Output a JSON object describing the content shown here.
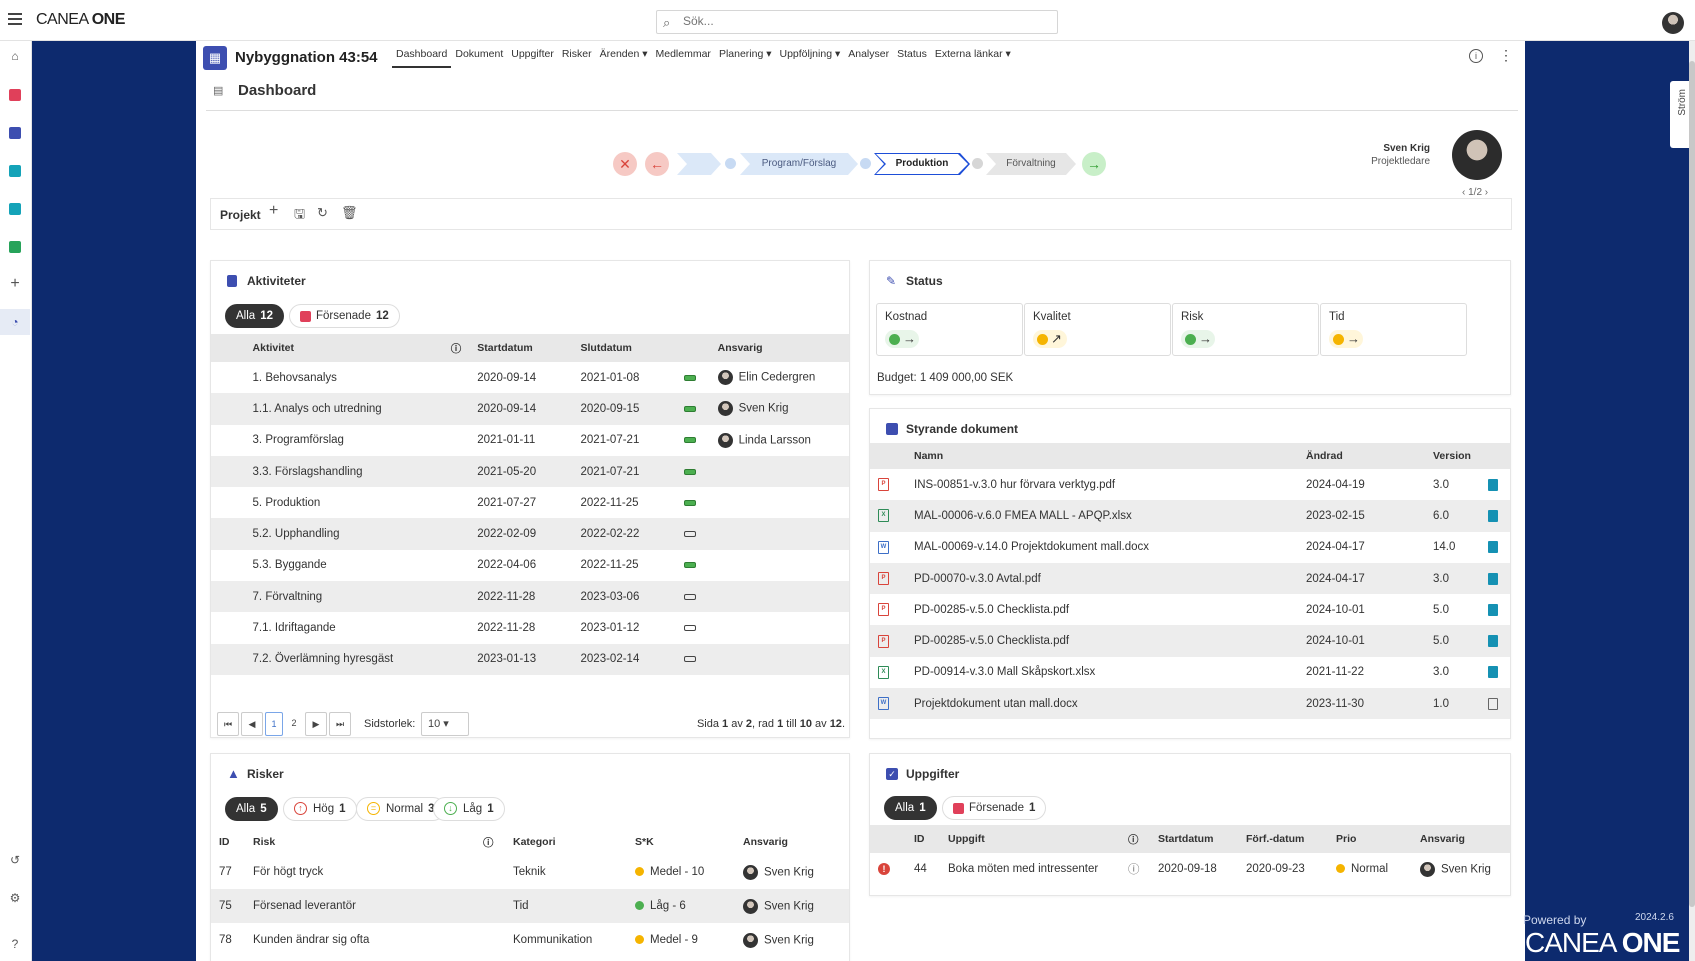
{
  "app": {
    "logo_light": "CANEA ",
    "logo_bold": "ONE"
  },
  "search": {
    "placeholder": "Sök..."
  },
  "project": {
    "title": "Nybyggnation 43:54",
    "tabs": [
      "Dashboard",
      "Dokument",
      "Uppgifter",
      "Risker",
      "Ärenden ▾",
      "Medlemmar",
      "Planering ▾",
      "Uppföljning ▾",
      "Analyser",
      "Status",
      "Externa länkar ▾"
    ],
    "active_tab": "Dashboard"
  },
  "page": {
    "title": "Dashboard"
  },
  "flow": {
    "steps": [
      "Program/Förslag",
      "Produktion",
      "Förvaltning"
    ],
    "active_step": "Produktion"
  },
  "manager": {
    "name": "Sven Krig",
    "role": "Projektledare",
    "pager": "1/2"
  },
  "toolbar": {
    "label": "Projekt"
  },
  "activities": {
    "title": "Aktiviteter",
    "filter_all_label": "Alla",
    "filter_all_count": "12",
    "filter_late_label": "Försenade",
    "filter_late_count": "12",
    "columns": [
      "Aktivitet",
      "Startdatum",
      "Slutdatum",
      "Ansvarig"
    ],
    "rows": [
      {
        "name": "1. Behovsanalys",
        "start": "2020-09-14",
        "end": "2021-01-08",
        "bar": "green",
        "owner": "Elin Cedergren"
      },
      {
        "name": "1.1. Analys och utredning",
        "start": "2020-09-14",
        "end": "2020-09-15",
        "bar": "green",
        "owner": "Sven Krig"
      },
      {
        "name": "3. Programförslag",
        "start": "2021-01-11",
        "end": "2021-07-21",
        "bar": "green",
        "owner": "Linda Larsson"
      },
      {
        "name": "3.3. Förslagshandling",
        "start": "2021-05-20",
        "end": "2021-07-21",
        "bar": "green",
        "owner": ""
      },
      {
        "name": "5. Produktion",
        "start": "2021-07-27",
        "end": "2022-11-25",
        "bar": "green",
        "owner": ""
      },
      {
        "name": "5.2. Upphandling",
        "start": "2022-02-09",
        "end": "2022-02-22",
        "bar": "empty",
        "owner": ""
      },
      {
        "name": "5.3. Byggande",
        "start": "2022-04-06",
        "end": "2022-11-25",
        "bar": "green",
        "owner": ""
      },
      {
        "name": "7. Förvaltning",
        "start": "2022-11-28",
        "end": "2023-03-06",
        "bar": "empty",
        "owner": ""
      },
      {
        "name": "7.1. Idriftagande",
        "start": "2022-11-28",
        "end": "2023-01-12",
        "bar": "empty",
        "owner": ""
      },
      {
        "name": "7.2. Överlämning hyresgäst",
        "start": "2023-01-13",
        "end": "2023-02-14",
        "bar": "empty",
        "owner": ""
      }
    ],
    "pager": {
      "pages": [
        "1",
        "2"
      ],
      "current": "1",
      "size_label": "Sidstorlek:",
      "size": "10",
      "summary_pre": "Sida ",
      "page": "1",
      "of": " av ",
      "total_pages": "2",
      "rad": ", rad ",
      "from": "1",
      "till": " till ",
      "to": "10",
      "av2": " av ",
      "total": "12",
      "dot": "."
    }
  },
  "status": {
    "title": "Status",
    "items": [
      {
        "label": "Kostnad",
        "color": "#4caf50",
        "trend": "→",
        "bg": "#e8f5e9"
      },
      {
        "label": "Kvalitet",
        "color": "#f5b400",
        "trend": "↗",
        "bg": "#fff6da"
      },
      {
        "label": "Risk",
        "color": "#4caf50",
        "trend": "→",
        "bg": "#e8f5e9"
      },
      {
        "label": "Tid",
        "color": "#f5b400",
        "trend": "→",
        "bg": "#fff6da"
      }
    ],
    "budget": "Budget: 1 409 000,00 SEK"
  },
  "documents": {
    "title": "Styrande dokument",
    "columns": [
      "Namn",
      "Ändrad",
      "Version"
    ],
    "rows": [
      {
        "type": "pdf",
        "name": "INS-00851-v.3.0 hur förvara verktyg.pdf",
        "changed": "2024-04-19",
        "version": "3.0",
        "vicon": "filled"
      },
      {
        "type": "xlsx",
        "name": "MAL-00006-v.6.0 FMEA MALL - APQP.xlsx",
        "changed": "2023-02-15",
        "version": "6.0",
        "vicon": "edit"
      },
      {
        "type": "docx",
        "name": "MAL-00069-v.14.0 Projektdokument mall.docx",
        "changed": "2024-04-17",
        "version": "14.0",
        "vicon": "filled"
      },
      {
        "type": "pdf",
        "name": "PD-00070-v.3.0 Avtal.pdf",
        "changed": "2024-04-17",
        "version": "3.0",
        "vicon": "filled"
      },
      {
        "type": "pdf",
        "name": "PD-00285-v.5.0 Checklista.pdf",
        "changed": "2024-10-01",
        "version": "5.0",
        "vicon": "filled"
      },
      {
        "type": "pdf",
        "name": "PD-00285-v.5.0 Checklista.pdf",
        "changed": "2024-10-01",
        "version": "5.0",
        "vicon": "filled"
      },
      {
        "type": "xlsx",
        "name": "PD-00914-v.3.0 Mall Skåpskort.xlsx",
        "changed": "2021-11-22",
        "version": "3.0",
        "vicon": "filled"
      },
      {
        "type": "docx",
        "name": "Projektdokument utan mall.docx",
        "changed": "2023-11-30",
        "version": "1.0",
        "vicon": "outline"
      }
    ]
  },
  "risks": {
    "title": "Risker",
    "filters": [
      {
        "label": "Alla",
        "count": "5",
        "icon": ""
      },
      {
        "label": "Hög",
        "count": "1",
        "icon": "↑"
      },
      {
        "label": "Normal",
        "count": "3",
        "icon": "="
      },
      {
        "label": "Låg",
        "count": "1",
        "icon": "↓"
      }
    ],
    "columns": [
      "ID",
      "Risk",
      "Kategori",
      "S*K",
      "Ansvarig"
    ],
    "rows": [
      {
        "id": "77",
        "risk": "För högt tryck",
        "category": "Teknik",
        "sk": "Medel - 10",
        "color": "#f5b400",
        "owner": "Sven Krig"
      },
      {
        "id": "75",
        "risk": "Försenad leverantör",
        "category": "Tid",
        "sk": "Låg - 6",
        "color": "#4caf50",
        "owner": "Sven Krig"
      },
      {
        "id": "78",
        "risk": "Kunden ändrar sig ofta",
        "category": "Kommunikation",
        "sk": "Medel - 9",
        "color": "#f5b400",
        "owner": "Sven Krig"
      }
    ]
  },
  "tasks": {
    "title": "Uppgifter",
    "filter_all_label": "Alla",
    "filter_all_count": "1",
    "filter_late_label": "Försenade",
    "filter_late_count": "1",
    "columns": [
      "ID",
      "Uppgift",
      "Startdatum",
      "Förf.-datum",
      "Prio",
      "Ansvarig"
    ],
    "rows": [
      {
        "id": "44",
        "task": "Boka möten med intressenter",
        "start": "2020-09-18",
        "due": "2020-09-23",
        "prio": "Normal",
        "owner": "Sven Krig"
      }
    ]
  },
  "stream": {
    "label": "Ström"
  },
  "footer": {
    "powered": "Powered by",
    "version": "2024.2.6",
    "brand_light": "CANEA ",
    "brand_bold": "ONE"
  }
}
